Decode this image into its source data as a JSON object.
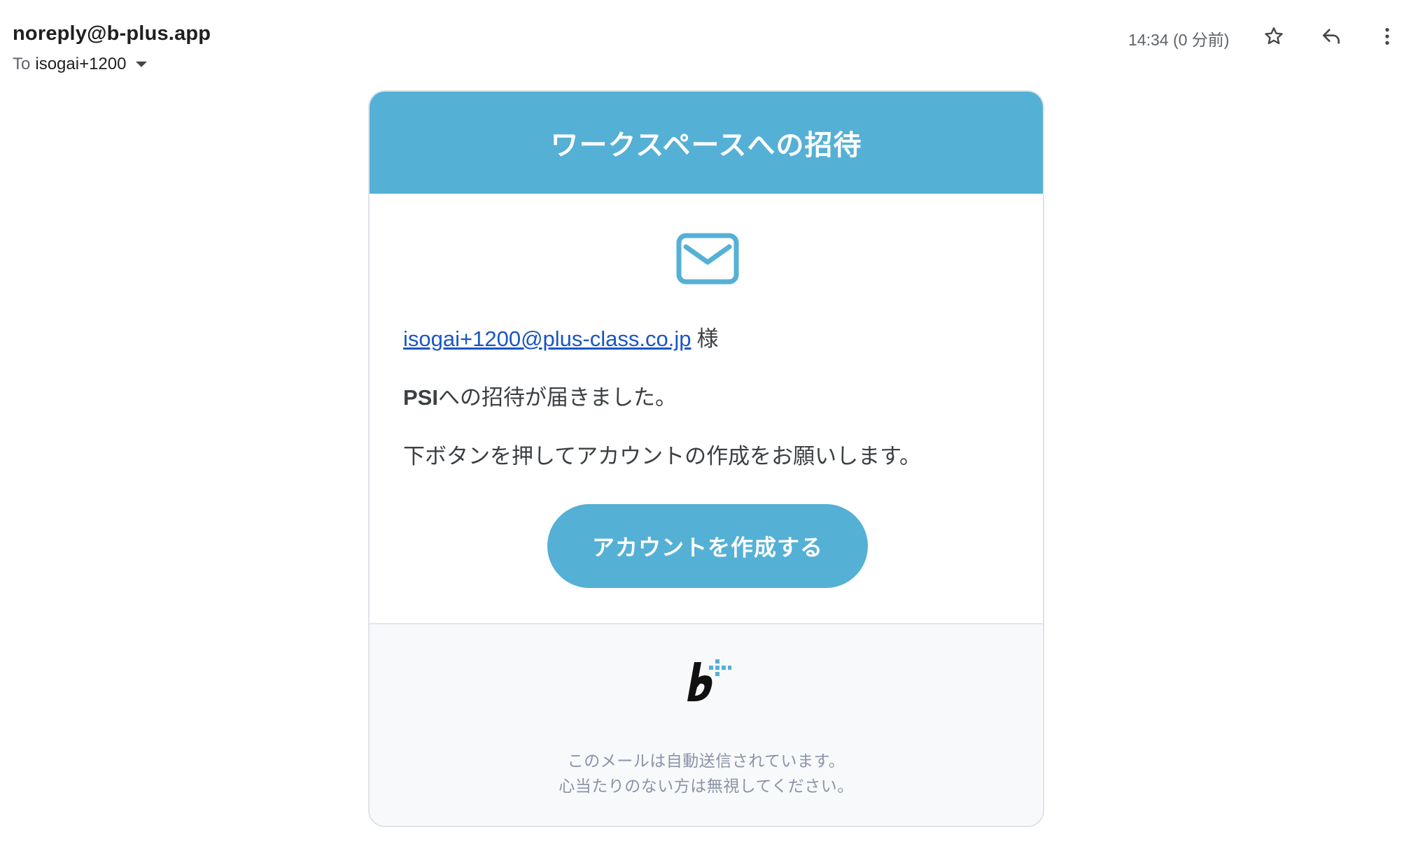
{
  "header": {
    "sender": "noreply@b-plus.app",
    "to_label": "To",
    "recipient": "isogai+1200",
    "timestamp": "14:34 (0 分前)",
    "icons": [
      "star-icon",
      "reply-icon",
      "more-vert-icon",
      "chevron-down-icon"
    ]
  },
  "email": {
    "title": "ワークスペースへの招待",
    "icon": "envelope-icon",
    "greeting_email": "isogai+1200@plus-class.co.jp",
    "greeting_honorific": "様",
    "org_name": "PSI",
    "invite_text": "への招待が届きました。",
    "instruction": "下ボタンを押してアカウントの作成をお願いします。",
    "button_label": "アカウントを作成する",
    "footer_logo": "b-plus-logo",
    "footer_note_1": "このメールは自動送信されています。",
    "footer_note_2": "心当たりのない方は無視してください。"
  },
  "colors": {
    "accent": "#55b0d5",
    "link": "#1a56c4",
    "footer_bg": "#f8f9fb",
    "footer_text": "#8a94a6"
  }
}
